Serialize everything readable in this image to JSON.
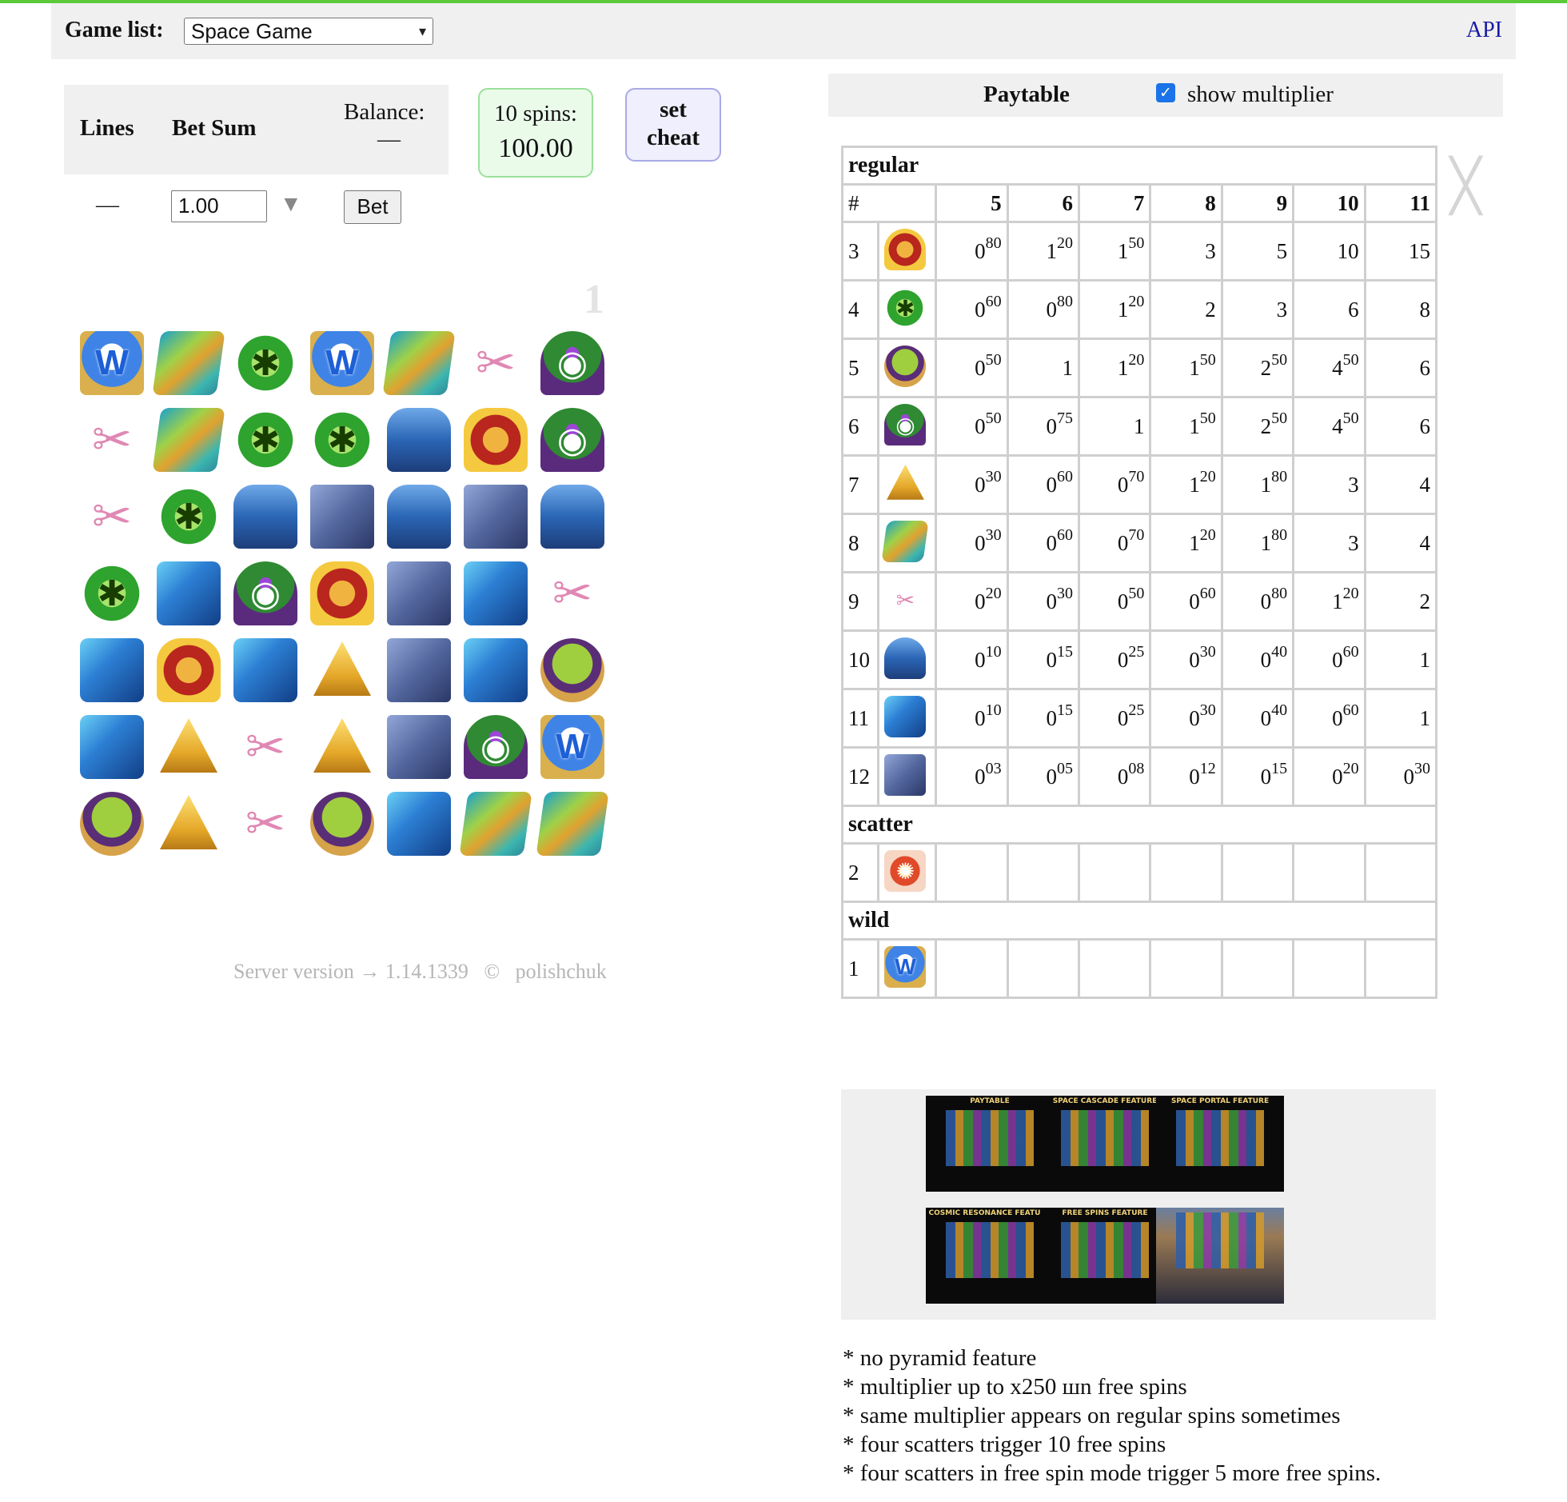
{
  "header": {
    "game_list_label": "Game list:",
    "selected_game": "Space Game",
    "api_link": "API"
  },
  "controls": {
    "lines_label": "Lines",
    "bet_sum_label": "Bet Sum",
    "balance_label": "Balance:",
    "balance_value": "—",
    "lines_value": "—",
    "bet_value": "1.00",
    "bet_button": "Bet",
    "spins_label": "10 spins:",
    "spins_value": "100.00",
    "cheat_line1": "set",
    "cheat_line2": "cheat"
  },
  "reels": {
    "counter": "1",
    "rows": [
      [
        "wild",
        "leaf",
        "scarab",
        "wild",
        "leaf",
        "whip",
        "helmet"
      ],
      [
        "whip",
        "leaf",
        "scarab",
        "scarab",
        "chest",
        "pharaoh",
        "helmet"
      ],
      [
        "whip",
        "scarab",
        "chest",
        "cube",
        "chest",
        "cube",
        "chest"
      ],
      [
        "scarab",
        "crystal",
        "helmet",
        "pharaoh",
        "cube",
        "crystal",
        "whip"
      ],
      [
        "crystal",
        "pharaoh",
        "crystal",
        "pyramid",
        "cube",
        "crystal",
        "alien"
      ],
      [
        "crystal",
        "pyramid",
        "whip",
        "pyramid",
        "cube",
        "helmet",
        "wild"
      ],
      [
        "alien",
        "pyramid",
        "whip",
        "alien",
        "crystal",
        "leaf",
        "leaf"
      ]
    ]
  },
  "footer": {
    "text": "Server version → 1.14.1339   ©   polishchuk"
  },
  "paytable": {
    "title": "Paytable",
    "show_multiplier_label": "show multiplier",
    "show_multiplier_checked": true,
    "section_regular": "regular",
    "section_scatter": "scatter",
    "section_wild": "wild",
    "hash": "#",
    "columns": [
      "5",
      "6",
      "7",
      "8",
      "9",
      "10",
      "11"
    ],
    "regular_rows": [
      {
        "id": "3",
        "icon": "pharaoh-icon",
        "sym": "pharaoh",
        "values": [
          "0.80",
          "1.20",
          "1.50",
          "3",
          "5",
          "10",
          "15"
        ]
      },
      {
        "id": "4",
        "icon": "scarab-icon",
        "sym": "scarab",
        "values": [
          "0.60",
          "0.80",
          "1.20",
          "2",
          "3",
          "6",
          "8"
        ]
      },
      {
        "id": "5",
        "icon": "alien-icon",
        "sym": "alien",
        "values": [
          "0.50",
          "1",
          "1.20",
          "1.50",
          "2.50",
          "4.50",
          "6"
        ]
      },
      {
        "id": "6",
        "icon": "helmet-icon",
        "sym": "helmet",
        "values": [
          "0.50",
          "0.75",
          "1",
          "1.50",
          "2.50",
          "4.50",
          "6"
        ]
      },
      {
        "id": "7",
        "icon": "pyramid-icon",
        "sym": "pyramid",
        "values": [
          "0.30",
          "0.60",
          "0.70",
          "1.20",
          "1.80",
          "3",
          "4"
        ]
      },
      {
        "id": "8",
        "icon": "leaf-icon",
        "sym": "leaf",
        "values": [
          "0.30",
          "0.60",
          "0.70",
          "1.20",
          "1.80",
          "3",
          "4"
        ]
      },
      {
        "id": "9",
        "icon": "whip-icon",
        "sym": "whip",
        "values": [
          "0.20",
          "0.30",
          "0.50",
          "0.60",
          "0.80",
          "1.20",
          "2"
        ]
      },
      {
        "id": "10",
        "icon": "chest-icon",
        "sym": "chest",
        "values": [
          "0.10",
          "0.15",
          "0.25",
          "0.30",
          "0.40",
          "0.60",
          "1"
        ]
      },
      {
        "id": "11",
        "icon": "crystal-icon",
        "sym": "crystal",
        "values": [
          "0.10",
          "0.15",
          "0.25",
          "0.30",
          "0.40",
          "0.60",
          "1"
        ]
      },
      {
        "id": "12",
        "icon": "cube-icon",
        "sym": "cube",
        "values": [
          "0.03",
          "0.05",
          "0.08",
          "0.12",
          "0.15",
          "0.20",
          "0.30"
        ]
      }
    ],
    "scatter_row": {
      "id": "2",
      "icon": "scatter-icon",
      "sym": "scatter"
    },
    "wild_row": {
      "id": "1",
      "icon": "wild-icon",
      "sym": "wild"
    }
  },
  "thumbnails": [
    {
      "title": "PAYTABLE"
    },
    {
      "title": "SPACE CASCADE FEATURE"
    },
    {
      "title": "SPACE PORTAL FEATURE"
    },
    {
      "title": "COSMIC RESONANCE FEATURE"
    },
    {
      "title": "FREE SPINS FEATURE"
    },
    {
      "title": ""
    }
  ],
  "notes": [
    "* no pyramid feature",
    "* multiplier up to x250 шn free spins",
    "* same multiplier appears on regular spins sometimes",
    "* four scatters trigger 10 free spins",
    "* four scatters in free spin mode trigger 5 more free spins."
  ]
}
